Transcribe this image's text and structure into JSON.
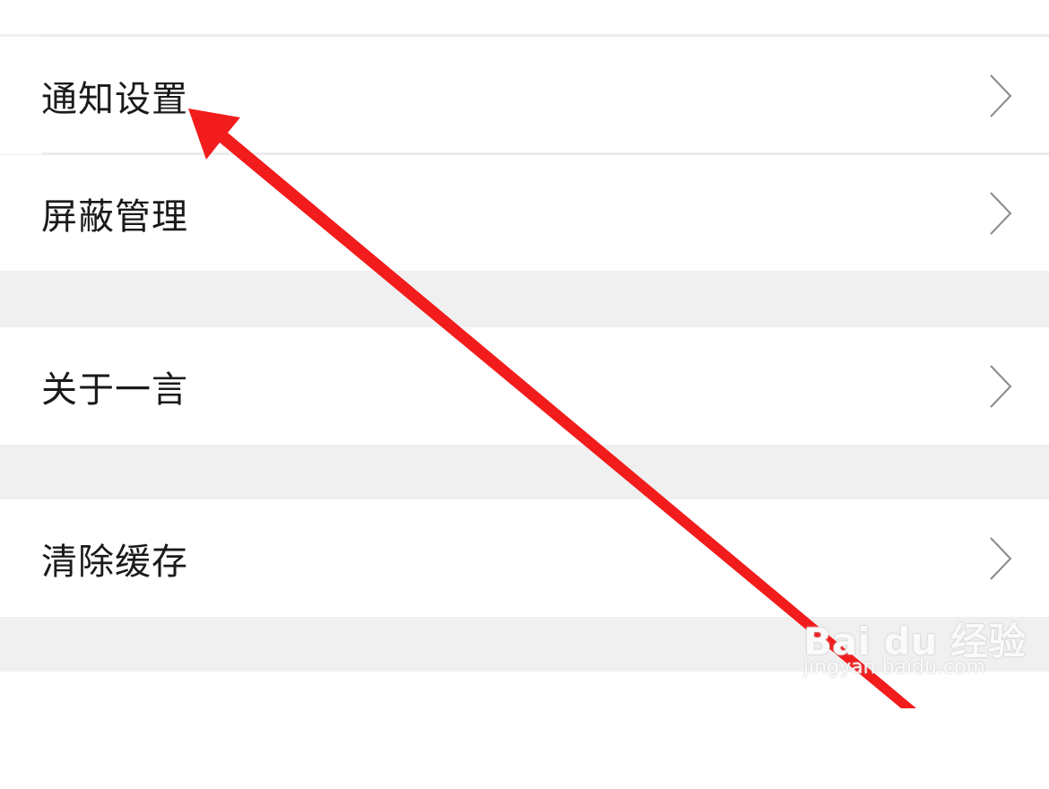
{
  "settings": {
    "items": [
      {
        "label": "通知设置",
        "chevron_icon": "chevron-right-icon"
      },
      {
        "label": "屏蔽管理",
        "chevron_icon": "chevron-right-icon"
      },
      {
        "label": "关于一言",
        "chevron_icon": "chevron-right-icon"
      },
      {
        "label": "清除缓存",
        "chevron_icon": "chevron-right-icon"
      }
    ]
  },
  "annotation": {
    "color": "#f21c1c",
    "icon": "red-arrow-annotation"
  },
  "watermark": {
    "logo_text": "Bai du 经验",
    "url": "jingyan.baidu.com"
  },
  "colors": {
    "background": "#f0f0f0",
    "cell": "#ffffff",
    "text": "#1a1a1a",
    "chevron": "#8a8a8a"
  }
}
